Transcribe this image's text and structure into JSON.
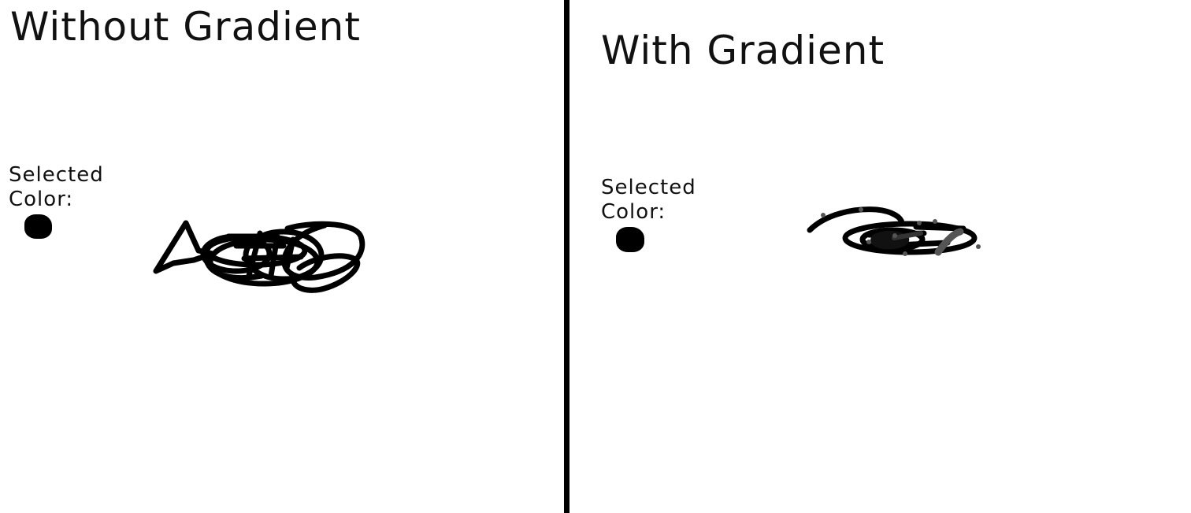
{
  "left_panel": {
    "title": "Without Gradient",
    "selected_label_line1": "Selected",
    "selected_label_line2": "Color:",
    "selected_color": "#000000"
  },
  "right_panel": {
    "title": "With Gradient",
    "selected_label_line1": "Selected",
    "selected_label_line2": "Color:",
    "selected_color": "#000000"
  },
  "colors": {
    "background": "#ffffff",
    "divider": "#000000",
    "stroke": "#000000",
    "gradient_stroke": "#555555"
  }
}
